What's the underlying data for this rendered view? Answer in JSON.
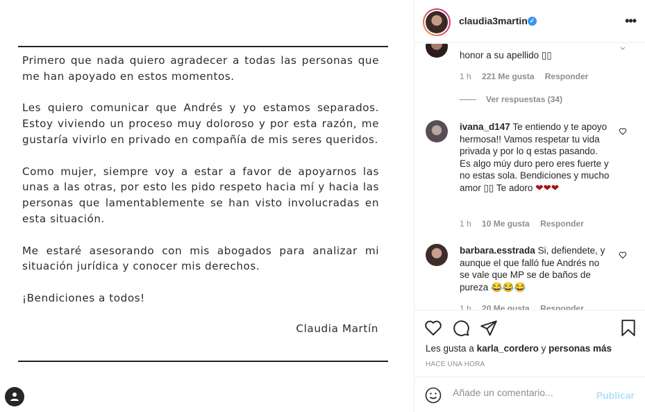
{
  "post": {
    "paragraphs": [
      "Primero que nada quiero agradecer a todas las personas que me han apoyado en estos momentos.",
      "Les quiero comunicar que Andrés y yo estamos separados. Estoy viviendo un proceso muy doloroso y por esta razón, me gustaría vivirlo en privado en compañía de mis seres queridos.",
      "Como mujer, siempre voy a estar a favor de apoyarnos las unas a las otras, por esto les pido respeto hacia mí y hacia las personas que lamentablemente se han visto involucradas en esta situación.",
      "Me estaré asesorando con mis abogados para analizar mi situación jurídica y conocer mis derechos.",
      "¡Bendiciones a todos!"
    ],
    "signature": "Claudia Martín"
  },
  "header": {
    "username": "claudia3martin",
    "verified_glyph": "✓",
    "more_label": "•••"
  },
  "comments": [
    {
      "username": "",
      "text": "honor a su apellido ▯▯",
      "time": "1 h",
      "likes": "221 Me gusta",
      "reply": "Responder",
      "view_replies": "Ver respuestas (34)"
    },
    {
      "username": "ivana_d147",
      "text": "Te entiendo y te apoyo hermosa!! Vamos respetar tu vida privada y por lo q estas pasando. Es algo múy duro pero eres fuerte y no estas sola. Bendiciones y mucho amor ▯▯ Te adoro",
      "hearts": "❤❤❤",
      "time": "1 h",
      "likes": "10 Me gusta",
      "reply": "Responder"
    },
    {
      "username": "barbara.esstrada",
      "text": "Si, defiendete, y aunque el que falló fue Andrés no se vale que MP se de baños de pureza",
      "emojis": "😂😂😂",
      "time": "1 h",
      "likes": "20 Me gusta",
      "reply": "Responder"
    }
  ],
  "actions": {
    "likes_prefix": "Les gusta a",
    "likes_user": "karla_cordero",
    "likes_middle": "y",
    "likes_suffix": "personas más",
    "time": "HACE UNA HORA"
  },
  "composer": {
    "placeholder": "Añade un comentario...",
    "publish_label": "Publicar"
  },
  "colors": {
    "link_blue": "#3897f0",
    "publish_disabled": "#b2dffc",
    "muted": "#8e8e8e",
    "heart_red": "#a4161a"
  }
}
